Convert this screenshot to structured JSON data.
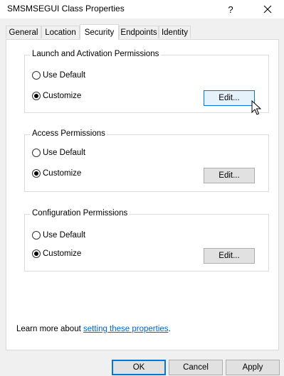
{
  "window": {
    "title": "SMSMSEGUI Class Properties",
    "help_label": "?"
  },
  "tabs": [
    {
      "label": "General",
      "active": false
    },
    {
      "label": "Location",
      "active": false
    },
    {
      "label": "Security",
      "active": true
    },
    {
      "label": "Endpoints",
      "active": false
    },
    {
      "label": "Identity",
      "active": false
    }
  ],
  "groups": [
    {
      "legend": "Launch and Activation Permissions",
      "use_default_label": "Use Default",
      "customize_label": "Customize",
      "selected": "customize",
      "edit_label": "Edit..."
    },
    {
      "legend": "Access Permissions",
      "use_default_label": "Use Default",
      "customize_label": "Customize",
      "selected": "customize",
      "edit_label": "Edit..."
    },
    {
      "legend": "Configuration Permissions",
      "use_default_label": "Use Default",
      "customize_label": "Customize",
      "selected": "customize",
      "edit_label": "Edit..."
    }
  ],
  "learn_more": {
    "prefix": "Learn more about ",
    "link_text": "setting these properties",
    "suffix": "."
  },
  "footer": {
    "ok_label": "OK",
    "cancel_label": "Cancel",
    "apply_label": "Apply"
  },
  "colors": {
    "accent": "#0078d7",
    "link": "#0066cc"
  }
}
